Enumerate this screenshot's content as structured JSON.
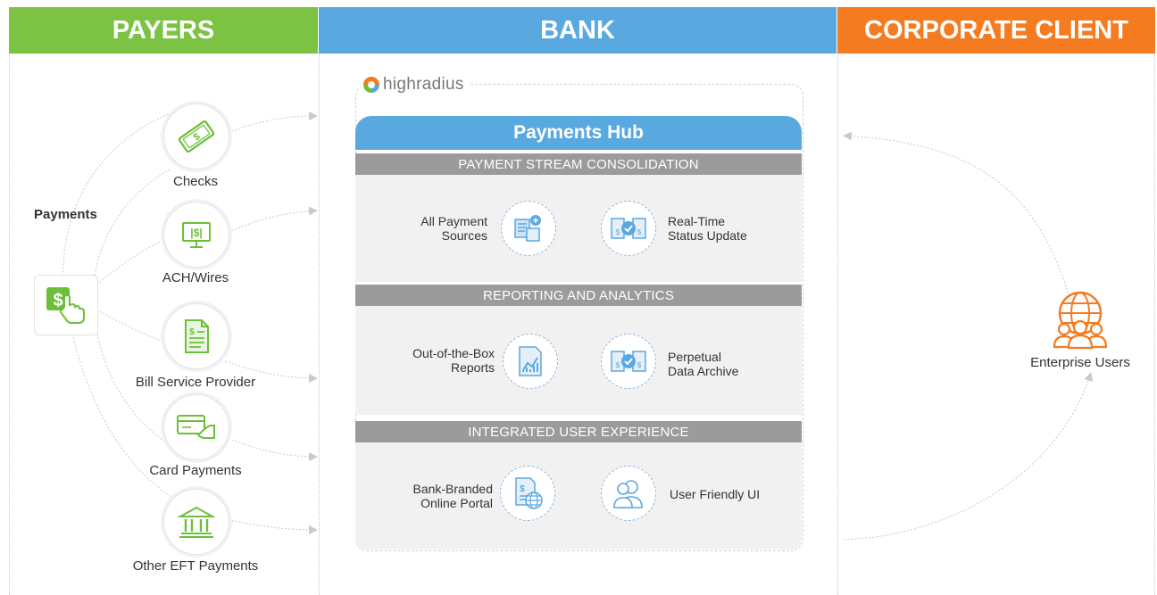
{
  "columns": {
    "payers": {
      "label": "PAYERS",
      "color": "#7cc243"
    },
    "bank": {
      "label": "BANK",
      "color": "#5aa8e0"
    },
    "corporate": {
      "label": "CORPORATE CLIENT",
      "color": "#f47b20"
    }
  },
  "payments_label": "Payments",
  "payers": [
    {
      "label": "Checks",
      "icon": "cash-bill-icon"
    },
    {
      "label": "ACH/Wires",
      "icon": "monitor-dollar-icon"
    },
    {
      "label": "Bill Service Provider",
      "icon": "document-dollar-icon"
    },
    {
      "label": "Card Payments",
      "icon": "card-in-hand-icon"
    },
    {
      "label": "Other EFT Payments",
      "icon": "bank-building-icon"
    }
  ],
  "hub": {
    "logo_text": "highradius",
    "title": "Payments Hub",
    "sections": [
      {
        "title": "PAYMENT STREAM CONSOLIDATION",
        "features": [
          {
            "label_line1": "All Payment",
            "label_line2": "Sources",
            "icon": "sources-icon"
          },
          {
            "label_line1": "Real-Time",
            "label_line2": "Status Update",
            "icon": "status-check-icon"
          }
        ]
      },
      {
        "title": "REPORTING AND ANALYTICS",
        "features": [
          {
            "label_line1": "Out-of-the-Box",
            "label_line2": "Reports",
            "icon": "report-chart-icon"
          },
          {
            "label_line1": "Perpetual",
            "label_line2": "Data Archive",
            "icon": "archive-check-icon"
          }
        ]
      },
      {
        "title": "INTEGRATED USER EXPERIENCE",
        "features": [
          {
            "label_line1": "Bank-Branded",
            "label_line2": "Online Portal",
            "icon": "portal-globe-icon"
          },
          {
            "label_line1": "User Friendly UI",
            "label_line2": "",
            "icon": "users-icon"
          }
        ]
      }
    ]
  },
  "enterprise_label": "Enterprise Users",
  "colors": {
    "green": "#6cbf3a",
    "blue_icon": "#5aa8e0",
    "orange": "#f47b20"
  }
}
